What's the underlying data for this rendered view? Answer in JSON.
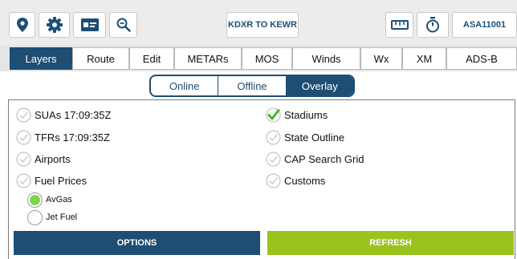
{
  "toolbar": {
    "route_label": "KDXR TO KEWR",
    "aircraft_label": "ASA11001",
    "icons": [
      "location-pin-icon",
      "gear-icon",
      "id-card-icon",
      "zoom-out-icon",
      "ruler-icon",
      "stopwatch-icon"
    ]
  },
  "tabs": [
    {
      "label": "Layers",
      "active": true
    },
    {
      "label": "Route"
    },
    {
      "label": "Edit"
    },
    {
      "label": "METARs"
    },
    {
      "label": "MOS"
    },
    {
      "label": "Winds"
    },
    {
      "label": "Wx"
    },
    {
      "label": "XM"
    },
    {
      "label": "ADS-B"
    }
  ],
  "segment": {
    "online": "Online",
    "offline": "Offline",
    "overlay": "Overlay",
    "selected": "Overlay"
  },
  "layers": {
    "left": [
      {
        "label": "SUAs 17:09:35Z",
        "checked": false
      },
      {
        "label": "TFRs 17:09:35Z",
        "checked": false
      },
      {
        "label": "Airports",
        "checked": false
      },
      {
        "label": "Fuel Prices",
        "checked": false
      }
    ],
    "right": [
      {
        "label": "Stadiums",
        "checked": true
      },
      {
        "label": "State Outline",
        "checked": false
      },
      {
        "label": "CAP Search Grid",
        "checked": false
      },
      {
        "label": "Customs",
        "checked": false
      }
    ],
    "fuel_options": [
      {
        "label": "AvGas",
        "selected": true
      },
      {
        "label": "Jet Fuel",
        "selected": false
      }
    ]
  },
  "buttons": {
    "options": "OPTIONS",
    "refresh": "REFRESH"
  },
  "colors": {
    "primary": "#1e4e74",
    "refresh": "#9ac31c",
    "check_green": "#3fbf1f",
    "radio_green": "#7dd84a"
  }
}
